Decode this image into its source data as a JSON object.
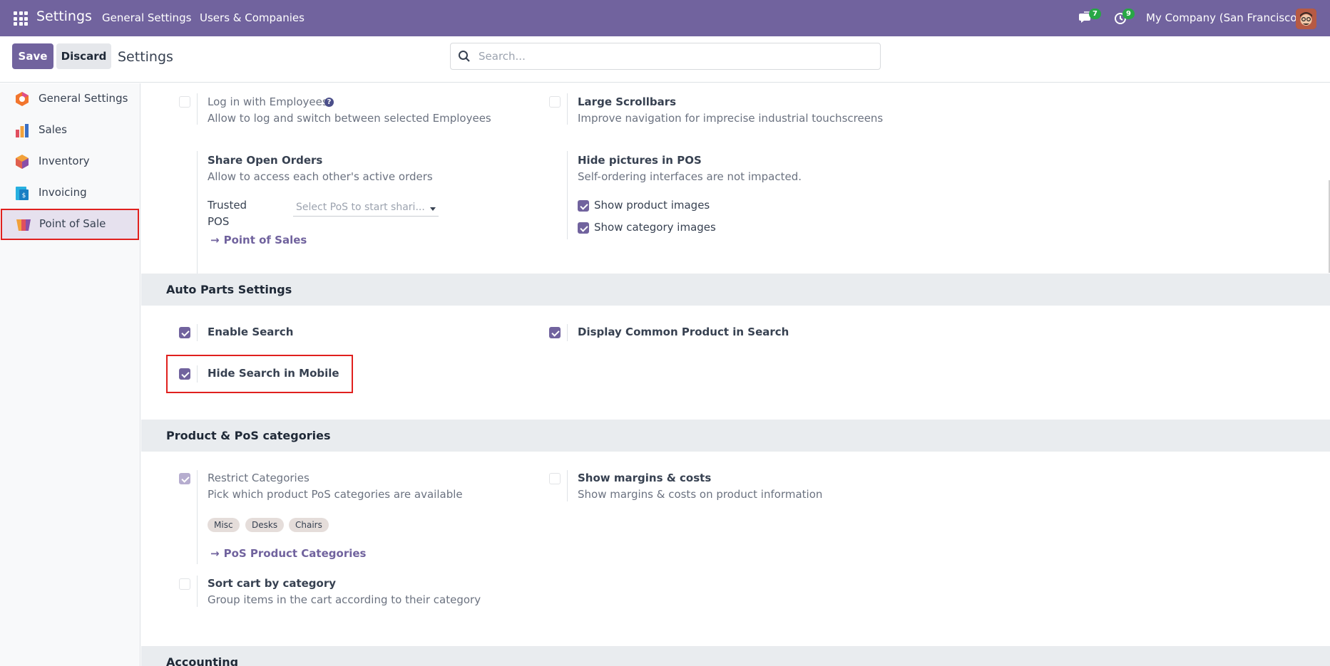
{
  "navbar": {
    "brand": "Settings",
    "menu": [
      "General Settings",
      "Users & Companies"
    ],
    "messages_count": "7",
    "activities_count": "9",
    "company": "My Company (San Francisco)",
    "accent_color": "#71639e"
  },
  "control_panel": {
    "save_label": "Save",
    "discard_label": "Discard",
    "title": "Settings",
    "search_placeholder": "Search..."
  },
  "sidebar": {
    "items": [
      {
        "label": "General Settings",
        "icon": "general-settings-icon"
      },
      {
        "label": "Sales",
        "icon": "sales-icon"
      },
      {
        "label": "Inventory",
        "icon": "inventory-icon"
      },
      {
        "label": "Invoicing",
        "icon": "invoicing-icon"
      },
      {
        "label": "Point of Sale",
        "icon": "point-of-sale-icon",
        "active": true
      }
    ]
  },
  "pos_settings": {
    "login_employees": {
      "title": "Log in with Employees",
      "desc": "Allow to log and switch between selected Employees",
      "checked": false
    },
    "large_scrollbars": {
      "title": "Large Scrollbars",
      "desc": "Improve navigation for imprecise industrial touchscreens",
      "checked": false
    },
    "share_orders": {
      "title": "Share Open Orders",
      "desc": "Allow to access each other's active orders",
      "field_label_1": "Trusted",
      "field_label_2": "POS",
      "select_placeholder": "Select PoS to start shari...",
      "link": "Point of Sales"
    },
    "hide_pictures": {
      "title": "Hide pictures in POS",
      "desc": "Self-ordering interfaces are not impacted.",
      "opt1": "Show product images",
      "opt2": "Show category images",
      "opt1_checked": true,
      "opt2_checked": true
    }
  },
  "auto_parts": {
    "section_title": "Auto Parts Settings",
    "enable_search": {
      "title": "Enable Search",
      "checked": true
    },
    "display_common": {
      "title": "Display Common Product in Search",
      "checked": true
    },
    "hide_mobile": {
      "title": "Hide Search in Mobile",
      "checked": true
    }
  },
  "categories": {
    "section_title": "Product & PoS categories",
    "restrict": {
      "title": "Restrict Categories",
      "desc": "Pick which product PoS categories are available",
      "checked": true,
      "tags": [
        "Misc",
        "Desks",
        "Chairs"
      ],
      "link": "PoS Product Categories"
    },
    "margins": {
      "title": "Show margins & costs",
      "desc": "Show margins & costs on product information",
      "checked": false
    },
    "sort_cart": {
      "title": "Sort cart by category",
      "desc": "Group items in the cart according to their category",
      "checked": false
    }
  },
  "accounting": {
    "section_title": "Accounting"
  }
}
